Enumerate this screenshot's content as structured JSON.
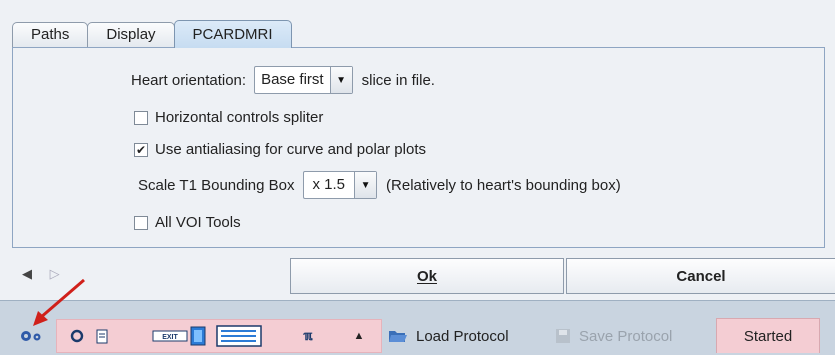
{
  "tabs": [
    {
      "label": "Paths"
    },
    {
      "label": "Display"
    },
    {
      "label": "PCARDMRI",
      "active": true
    }
  ],
  "settings": {
    "heart_orientation_label": "Heart orientation:",
    "heart_orientation_value": "Base first",
    "heart_orientation_suffix": "slice in file.",
    "horizontal_controls_label": "Horizontal controls spliter",
    "horizontal_controls_checked": false,
    "antialiasing_label": "Use antialiasing for curve and polar plots",
    "antialiasing_checked": true,
    "scale_label": "Scale T1 Bounding Box",
    "scale_value": "x 1.5",
    "scale_suffix": "(Relatively to heart's bounding box)",
    "voi_tools_label": "All VOI Tools",
    "voi_tools_checked": false
  },
  "buttons": {
    "ok_label": "Ok",
    "cancel_label": "Cancel"
  },
  "taskbar": {
    "load_protocol": "Load Protocol",
    "save_protocol": "Save Protocol",
    "started": "Started"
  },
  "colors": {
    "accent_tab": "#c6dcf1",
    "taskbar_pink": "#f4cdd3",
    "annotation_arrow": "#d0201a"
  }
}
